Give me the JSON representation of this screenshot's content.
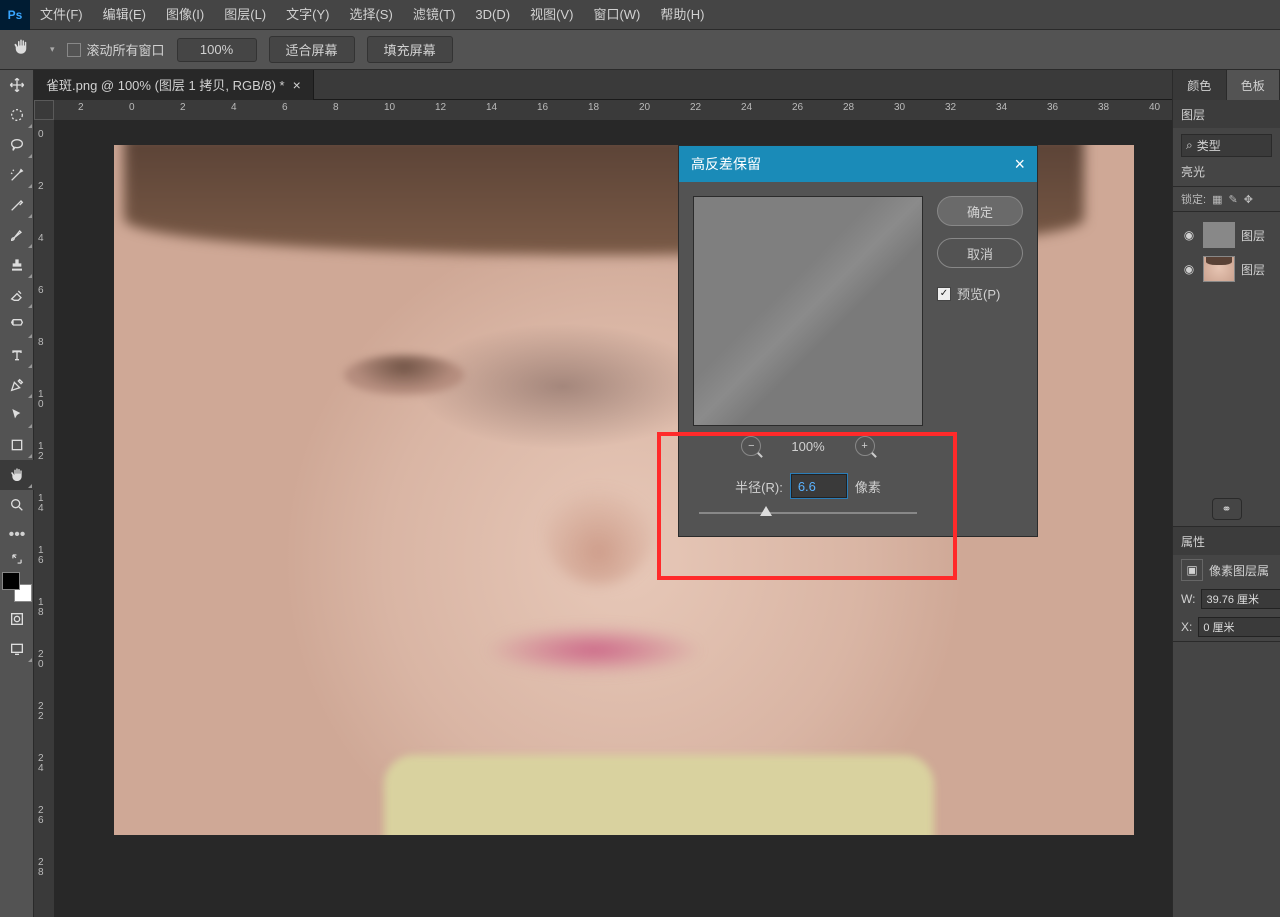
{
  "menubar": {
    "logo": "Ps",
    "items": [
      "文件(F)",
      "编辑(E)",
      "图像(I)",
      "图层(L)",
      "文字(Y)",
      "选择(S)",
      "滤镜(T)",
      "3D(D)",
      "视图(V)",
      "窗口(W)",
      "帮助(H)"
    ]
  },
  "options": {
    "scroll_all_label": "滚动所有窗口",
    "zoom": "100%",
    "fit_screen": "适合屏幕",
    "fill_screen": "填充屏幕"
  },
  "document": {
    "tab_title": "雀斑.png @ 100% (图层 1 拷贝, RGB/8) *"
  },
  "ruler_h": [
    "2",
    "0",
    "2",
    "4",
    "6",
    "8",
    "10",
    "12",
    "14",
    "16",
    "18",
    "20",
    "22",
    "24",
    "26",
    "28",
    "30",
    "32",
    "34",
    "36",
    "38",
    "40"
  ],
  "ruler_v": [
    "0",
    "2",
    "4",
    "6",
    "8",
    "10",
    "12",
    "14",
    "16",
    "18",
    "20",
    "22",
    "24",
    "26",
    "28"
  ],
  "dialog": {
    "title": "高反差保留",
    "ok": "确定",
    "cancel": "取消",
    "preview": "预览(P)",
    "zoom_label": "100%",
    "radius_label": "半径(R):",
    "radius_value": "6.6",
    "radius_unit": "像素"
  },
  "panels": {
    "color_tab": "颜色",
    "swatches_tab": "色板",
    "layers_tab": "图层",
    "type_placeholder": "类型",
    "blend_mode": "亮光",
    "lock_label": "锁定:",
    "layer1": "图层",
    "layer2": "图层",
    "properties_tab": "属性",
    "prop_label": "像素图层属",
    "w_label": "W:",
    "w_value": "39.76 厘米",
    "x_label": "X:",
    "x_value": "0 厘米",
    "link": "⚭"
  },
  "glyphs": {
    "close": "×",
    "check": "✓",
    "minus": "−",
    "plus": "+",
    "search": "⌕",
    "eye": "👁",
    "hand": "✋",
    "arrow_down": "▾"
  }
}
